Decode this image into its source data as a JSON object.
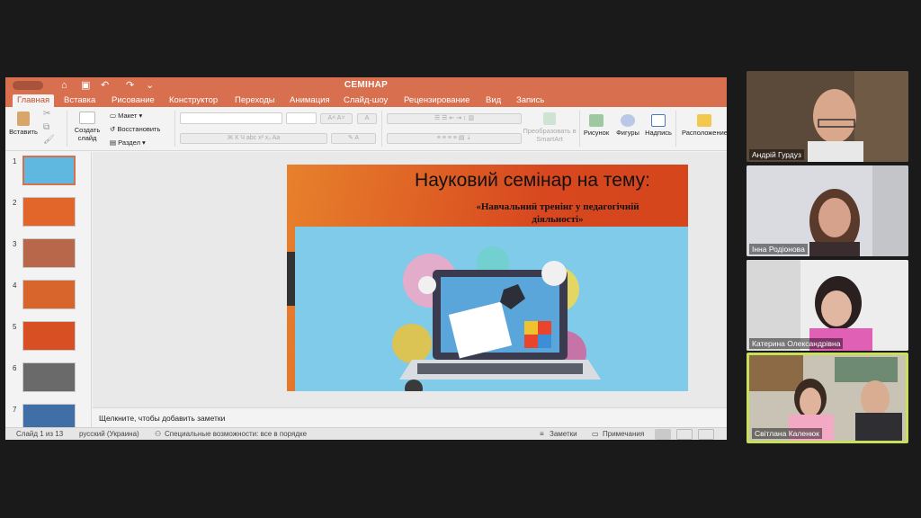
{
  "window": {
    "title": "СЕМІНАР",
    "tabs": [
      "Главная",
      "Вставка",
      "Рисование",
      "Конструктор",
      "Переходы",
      "Анимация",
      "Слайд-шоу",
      "Рецензирование",
      "Вид",
      "Запись"
    ],
    "active_tab": "Главная"
  },
  "ribbon": {
    "paste": "Вставить",
    "new_slide": "Создать слайд",
    "layout": "Макет",
    "reset": "Восстановить",
    "section": "Раздел",
    "convert_smartart": "Преобразовать в SmartArt",
    "picture": "Рисунок",
    "shapes": "Фигуры",
    "text_box": "Надпись",
    "arrange": "Расположение"
  },
  "thumbnails": [
    {
      "num": "1",
      "color": "#5fb8e0"
    },
    {
      "num": "2",
      "color": "#e2652a"
    },
    {
      "num": "3",
      "color": "#b9674a"
    },
    {
      "num": "4",
      "color": "#d8662c"
    },
    {
      "num": "5",
      "color": "#d94f24"
    },
    {
      "num": "6",
      "color": "#6a6a6a"
    },
    {
      "num": "7",
      "color": "#3f6fa6"
    }
  ],
  "slide": {
    "title": "Науковий семінар на тему:",
    "subtitle": "«Навчальний тренінг у педагогічній діяльності»"
  },
  "notes_placeholder": "Щелкните, чтобы добавить заметки",
  "status": {
    "slide_counter": "Слайд 1 из 13",
    "language": "русский (Украина)",
    "accessibility": "Специальные возможности: все в порядке",
    "notes_btn": "Заметки",
    "comments_btn": "Примечания"
  },
  "participants": [
    {
      "name": "Андрій Гурдуз",
      "bg": "#5b4a3a",
      "active": false
    },
    {
      "name": "Інна Родіонова",
      "bg": "#d9dbe0",
      "active": false
    },
    {
      "name": "Катерина Олександрівна",
      "bg": "#ededed",
      "active": false
    },
    {
      "name": "Світлана Каленюк",
      "bg": "#a7b6a4",
      "active": true
    }
  ],
  "colors": {
    "accent": "#d86f4e",
    "active_speaker": "#c9e05a"
  }
}
